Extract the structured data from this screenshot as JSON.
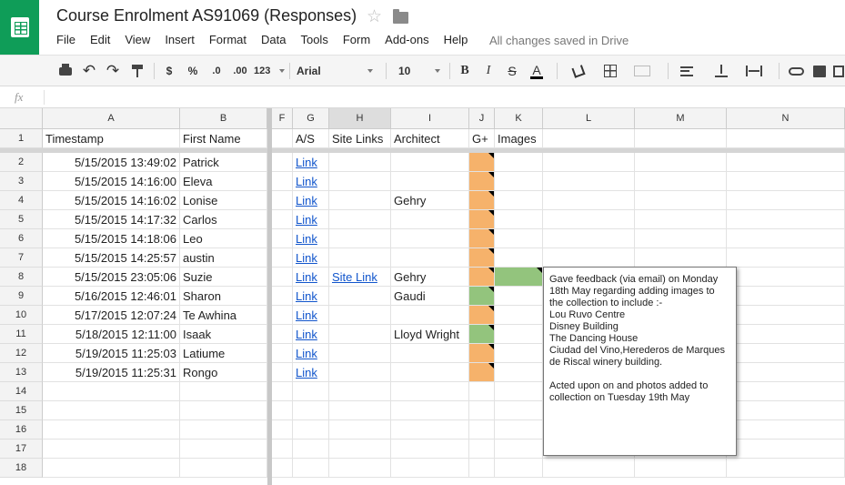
{
  "app": {
    "title": "Course Enrolment AS91069 (Responses)",
    "save_status": "All changes saved in Drive",
    "menu": [
      "File",
      "Edit",
      "View",
      "Insert",
      "Format",
      "Data",
      "Tools",
      "Form",
      "Add-ons",
      "Help"
    ]
  },
  "toolbar": {
    "currency": "$",
    "percent": "%",
    "dec_decrease": ".0",
    "dec_increase": ".00",
    "more_formats": "123",
    "font": "Arial",
    "font_size": "10",
    "bold": "B",
    "italic": "I",
    "strike": "S",
    "text_color": "A"
  },
  "formula_bar": {
    "fx": "fx",
    "value": ""
  },
  "columns": [
    {
      "letter": "A"
    },
    {
      "letter": "B"
    },
    {
      "letter": "F"
    },
    {
      "letter": "G"
    },
    {
      "letter": "H"
    },
    {
      "letter": "I"
    },
    {
      "letter": "J"
    },
    {
      "letter": "K"
    },
    {
      "letter": "L"
    },
    {
      "letter": "M"
    },
    {
      "letter": "N"
    }
  ],
  "header_row": [
    "Timestamp",
    "First Name",
    "",
    "A/S",
    "Site Links",
    "Architect",
    "G+",
    "Images",
    "",
    "",
    ""
  ],
  "rows": [
    {
      "n": "2",
      "ts": "5/15/2015 13:49:02",
      "name": "Patrick",
      "as": "Link",
      "site": "",
      "arch": "",
      "gplus": "orange",
      "images": ""
    },
    {
      "n": "3",
      "ts": "5/15/2015 14:16:00",
      "name": "Eleva",
      "as": "Link",
      "site": "",
      "arch": "",
      "gplus": "orange",
      "images": ""
    },
    {
      "n": "4",
      "ts": "5/15/2015 14:16:02",
      "name": "Lonise",
      "as": "Link",
      "site": "",
      "arch": "Gehry",
      "gplus": "orange",
      "images": ""
    },
    {
      "n": "5",
      "ts": "5/15/2015 14:17:32",
      "name": "Carlos",
      "as": "Link",
      "site": "",
      "arch": "",
      "gplus": "orange",
      "images": ""
    },
    {
      "n": "6",
      "ts": "5/15/2015 14:18:06",
      "name": "Leo",
      "as": "Link",
      "site": "",
      "arch": "",
      "gplus": "orange",
      "images": ""
    },
    {
      "n": "7",
      "ts": "5/15/2015 14:25:57",
      "name": "austin",
      "as": "Link",
      "site": "",
      "arch": "",
      "gplus": "orange",
      "images": ""
    },
    {
      "n": "8",
      "ts": "5/15/2015 23:05:06",
      "name": "Suzie",
      "as": "Link",
      "site": "Site Link",
      "arch": "Gehry",
      "gplus": "orange",
      "images": "green"
    },
    {
      "n": "9",
      "ts": "5/16/2015 12:46:01",
      "name": "Sharon",
      "as": "Link",
      "site": "",
      "arch": "Gaudi",
      "gplus": "green",
      "images": ""
    },
    {
      "n": "10",
      "ts": "5/17/2015 12:07:24",
      "name": "Te Awhina",
      "as": "Link",
      "site": "",
      "arch": "",
      "gplus": "orange",
      "images": ""
    },
    {
      "n": "11",
      "ts": "5/18/2015 12:11:00",
      "name": "Isaak",
      "as": "Link",
      "site": "",
      "arch": "Lloyd Wright",
      "gplus": "green",
      "images": ""
    },
    {
      "n": "12",
      "ts": "5/19/2015 11:25:03",
      "name": "Latiume",
      "as": "Link",
      "site": "",
      "arch": "",
      "gplus": "orange",
      "images": ""
    },
    {
      "n": "13",
      "ts": "5/19/2015 11:25:31",
      "name": "Rongo",
      "as": "Link",
      "site": "",
      "arch": "",
      "gplus": "orange",
      "images": ""
    }
  ],
  "empty_rows": [
    "14",
    "15",
    "16",
    "17",
    "18"
  ],
  "note": {
    "text": "Gave feedback (via email) on Monday 18th May regarding adding images to the collection to include :-\nLou Ruvo Centre\nDisney Building\nThe Dancing House\nCiudad del Vino,Herederos de Marques de Riscal winery building.\n\nActed upon on and photos added to collection on Tuesday 19th May"
  },
  "colors": {
    "brand": "#0f9d58",
    "link": "#1155cc",
    "fill_orange": "#f6b26b",
    "fill_green": "#93c47d"
  }
}
